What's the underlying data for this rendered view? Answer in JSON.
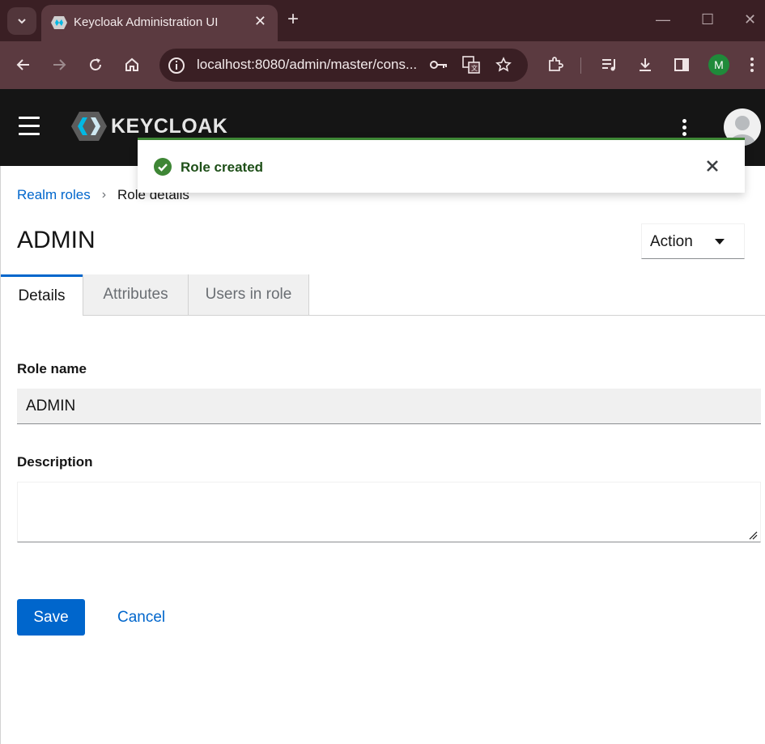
{
  "browser": {
    "tab_title": "Keycloak Administration UI",
    "url": "localhost:8080/admin/master/cons...",
    "profile_initial": "M"
  },
  "app": {
    "logo_text": "KEYCLOAK"
  },
  "toast": {
    "message": "Role created"
  },
  "breadcrumb": {
    "parent": "Realm roles",
    "current": "Role details"
  },
  "page": {
    "title": "ADMIN",
    "action_label": "Action"
  },
  "tabs": [
    {
      "label": "Details"
    },
    {
      "label": "Attributes"
    },
    {
      "label": "Users in role"
    }
  ],
  "form": {
    "role_name_label": "Role name",
    "role_name_value": "ADMIN",
    "description_label": "Description",
    "description_value": "",
    "save_label": "Save",
    "cancel_label": "Cancel"
  },
  "colors": {
    "primary": "#0066cc",
    "success": "#3e8635",
    "header_bg": "#151515"
  }
}
